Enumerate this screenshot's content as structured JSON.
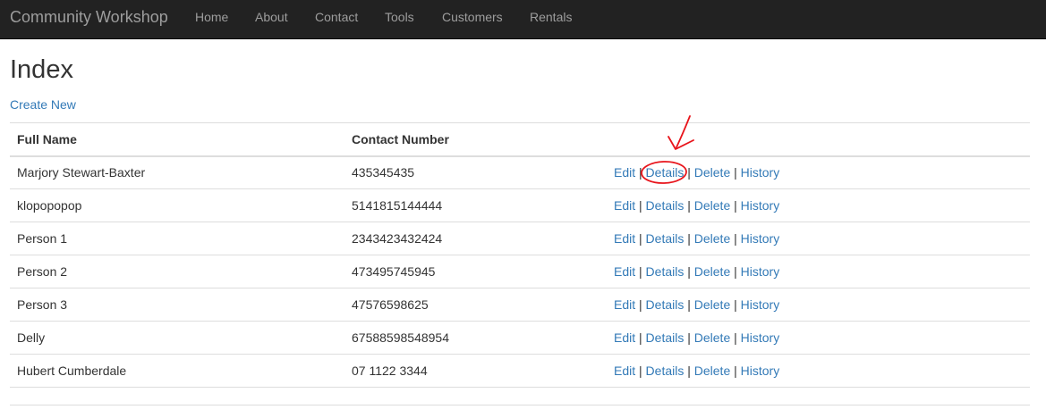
{
  "navbar": {
    "brand": "Community Workshop",
    "links": [
      "Home",
      "About",
      "Contact",
      "Tools",
      "Customers",
      "Rentals"
    ]
  },
  "page": {
    "title": "Index",
    "create_new": "Create New"
  },
  "table": {
    "headers": [
      "Full Name",
      "Contact Number"
    ],
    "rows": [
      {
        "name": "Marjory Stewart-Baxter",
        "contact": "435345435"
      },
      {
        "name": "klopopopop",
        "contact": "5141815144444"
      },
      {
        "name": "Person 1",
        "contact": "2343423432424"
      },
      {
        "name": "Person 2",
        "contact": "473495745945"
      },
      {
        "name": "Person 3",
        "contact": "47576598625"
      },
      {
        "name": "Delly",
        "contact": "67588598548954"
      },
      {
        "name": "Hubert Cumberdale",
        "contact": "07 1122 3344"
      }
    ],
    "actions": {
      "edit": "Edit",
      "details": "Details",
      "delete": "Delete",
      "history": "History",
      "separator": "|"
    }
  },
  "colors": {
    "navbar_bg": "#222222",
    "nav_text": "#9d9d9d",
    "link": "#337ab7",
    "annotation": "#e8141b"
  }
}
